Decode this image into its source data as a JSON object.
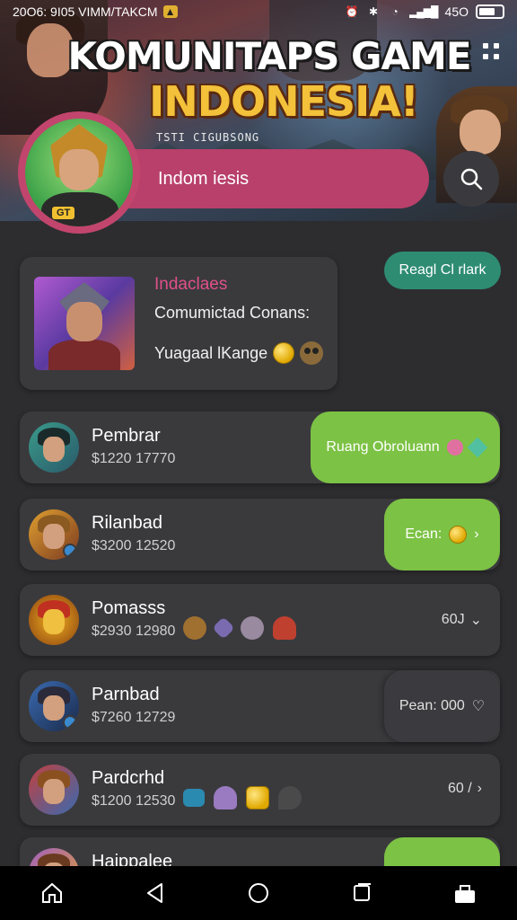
{
  "status_bar": {
    "time_text": "20O6: 9I05 VIMM/TAKCM",
    "signal_text": "45O"
  },
  "banner": {
    "title_line1": "KOMUNITAPS GAME",
    "title_line2": "INDONESIA!",
    "subtitle": "TSTI CIGUBSONG"
  },
  "profile": {
    "badge": "GT"
  },
  "search": {
    "value": "Indom iesis"
  },
  "info_card": {
    "title": "Indaclaes",
    "subtitle": "Comumictad Conans:",
    "third_line": "Yuagaal lKange"
  },
  "reagl_button": "Reagl Cl rlark",
  "rows": [
    {
      "name": "Pembrar",
      "price": "$1220 17770",
      "action_label": "Ruang Obroluann"
    },
    {
      "name": "Rilanbad",
      "price": "$3200 12520",
      "action_label": "Ecan:"
    },
    {
      "name": "Pomasss",
      "price": "$2930 12980",
      "value": "60J"
    },
    {
      "name": "Parnbad",
      "price": "$7260 12729",
      "action_label": "Pean: 000"
    },
    {
      "name": "Pardcrhd",
      "price": "$1200 12530",
      "value": "60 /"
    },
    {
      "name": "Haippalee",
      "price": ""
    }
  ],
  "colors": {
    "accent_pink": "#b8406a",
    "accent_green": "#7cc244",
    "accent_teal": "#2e8c73",
    "card_bg": "#3a3a3d"
  },
  "icons": {
    "search": "search-icon",
    "menu": "grid-menu-icon",
    "nav_home": "home-icon",
    "nav_back": "back-icon",
    "nav_circle": "home-circle-icon",
    "nav_recent": "recent-apps-icon",
    "nav_store": "store-icon"
  }
}
